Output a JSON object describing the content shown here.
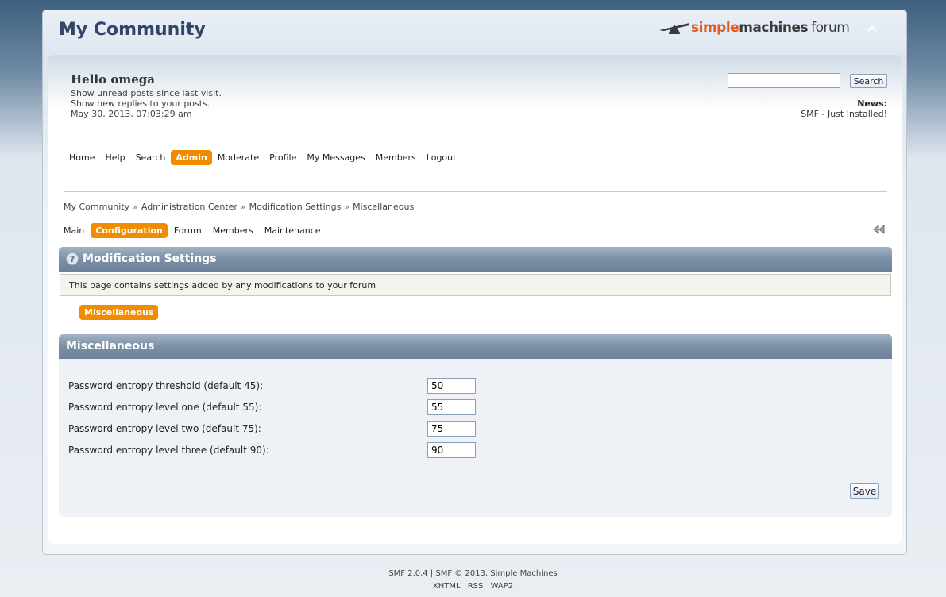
{
  "header": {
    "forum_title": "My Community",
    "logo": {
      "word1": "simple",
      "word2": "machines",
      "word3": "forum"
    },
    "collapse_icon": "chevron-up-icon"
  },
  "user": {
    "greeting": "Hello omega",
    "unread_posts": "Show unread posts since last visit.",
    "new_replies": "Show new replies to your posts.",
    "datetime": "May 30, 2013, 07:03:29 am"
  },
  "search": {
    "value": "",
    "button_label": "Search"
  },
  "news": {
    "title": "News:",
    "text": "SMF - Just Installed!"
  },
  "main_menu": [
    {
      "label": "Home",
      "active": false
    },
    {
      "label": "Help",
      "active": false
    },
    {
      "label": "Search",
      "active": false
    },
    {
      "label": "Admin",
      "active": true
    },
    {
      "label": "Moderate",
      "active": false
    },
    {
      "label": "Profile",
      "active": false
    },
    {
      "label": "My Messages",
      "active": false
    },
    {
      "label": "Members",
      "active": false
    },
    {
      "label": "Logout",
      "active": false
    }
  ],
  "breadcrumb": [
    "My Community",
    "Administration Center",
    "Modification Settings",
    "Miscellaneous"
  ],
  "breadcrumb_separator": "»",
  "admin_tabs": [
    {
      "label": "Main",
      "active": false
    },
    {
      "label": "Configuration",
      "active": true
    },
    {
      "label": "Forum",
      "active": false
    },
    {
      "label": "Members",
      "active": false
    },
    {
      "label": "Maintenance",
      "active": false
    }
  ],
  "collapse_sidebar_icon": "double-chevron-left-icon",
  "section": {
    "title": "Modification Settings",
    "icon": "help-icon",
    "description": "This page contains settings added by any modifications to your forum",
    "sub_tab": "Miscellaneous"
  },
  "settings": {
    "title": "Miscellaneous",
    "rows": [
      {
        "label": "Password entropy threshold (default 45):",
        "value": "50"
      },
      {
        "label": "Password entropy level one (default 55):",
        "value": "55"
      },
      {
        "label": "Password entropy level two (default 75):",
        "value": "75"
      },
      {
        "label": "Password entropy level three (default 90):",
        "value": "90"
      }
    ],
    "save_label": "Save"
  },
  "footer": {
    "line1": "SMF 2.0.4 | SMF © 2013, Simple Machines",
    "links": [
      "XHTML",
      "RSS",
      "WAP2"
    ]
  },
  "colors": {
    "accent": "#f08c00",
    "title": "#334466",
    "catbar": "#7b8fa6"
  }
}
